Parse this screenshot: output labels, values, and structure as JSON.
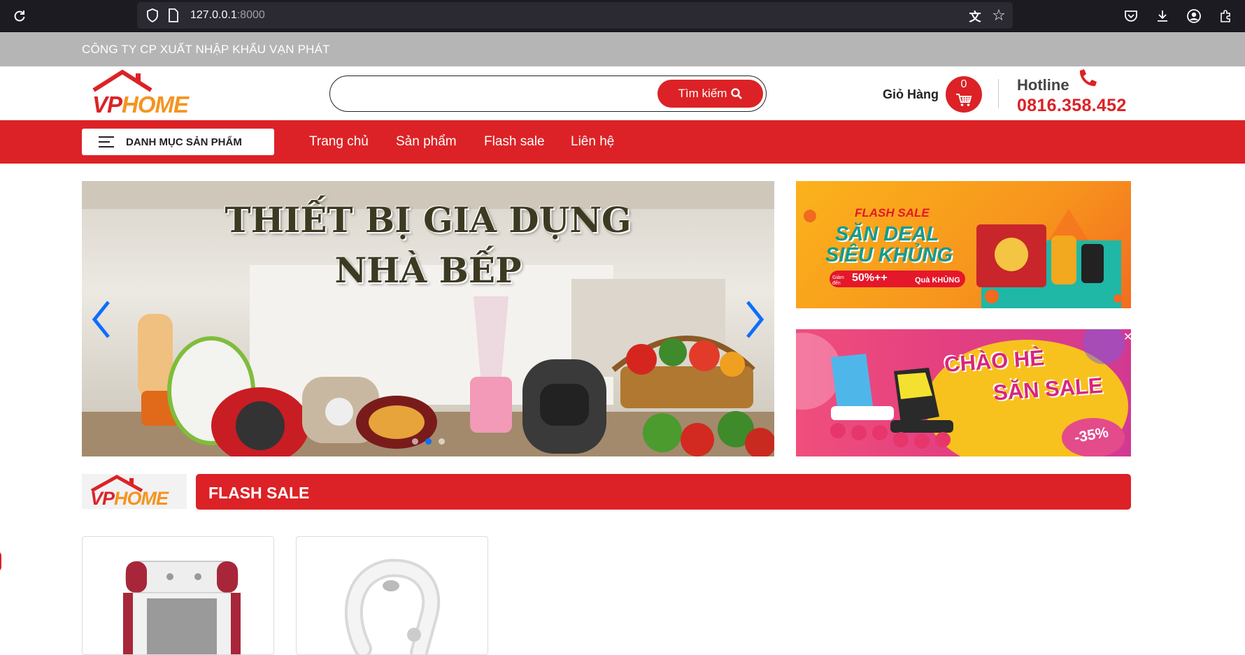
{
  "browser": {
    "url_host": "127.0.0.1",
    "url_port": ":8000"
  },
  "topbar": {
    "company": "CÔNG TY CP XUẤT NHẬP KHẨU VẠN PHÁT"
  },
  "header": {
    "logo_vp": "VP",
    "logo_home": "HOME",
    "search_placeholder": "",
    "search_button": "Tìm kiếm",
    "cart_label": "Giỏ Hàng",
    "cart_count": "0",
    "hotline_label": "Hotline",
    "hotline_number": "0816.358.452"
  },
  "nav": {
    "category_button": "DANH MỤC SẢN PHẨM",
    "links": [
      "Trang chủ",
      "Sản phẩm",
      "Flash sale",
      "Liên hệ"
    ]
  },
  "hero": {
    "title_line1": "THIẾT BỊ GIA DỤNG",
    "title_line2": "NHÀ BẾP",
    "active_slide": 1,
    "slide_count": 3
  },
  "banners": {
    "flash": {
      "tag": "FLASH SALE",
      "line1": "SĂN DEAL",
      "line2": "SIÊU KHỦNG",
      "pill_left": "50%++",
      "pill_prefix": "Giảm đến",
      "pill_right": "Quà KHỦNG"
    },
    "summer": {
      "line1": "CHÀO HÈ",
      "line2": "SĂN SALE",
      "discount": "-35%"
    }
  },
  "flash_sale": {
    "logo_vp": "VP",
    "logo_home": "HOME",
    "title": "FLASH SALE"
  },
  "colors": {
    "brand_red": "#dc2226",
    "brand_orange": "#f49420",
    "topbar_gray": "#b5b5b5"
  }
}
